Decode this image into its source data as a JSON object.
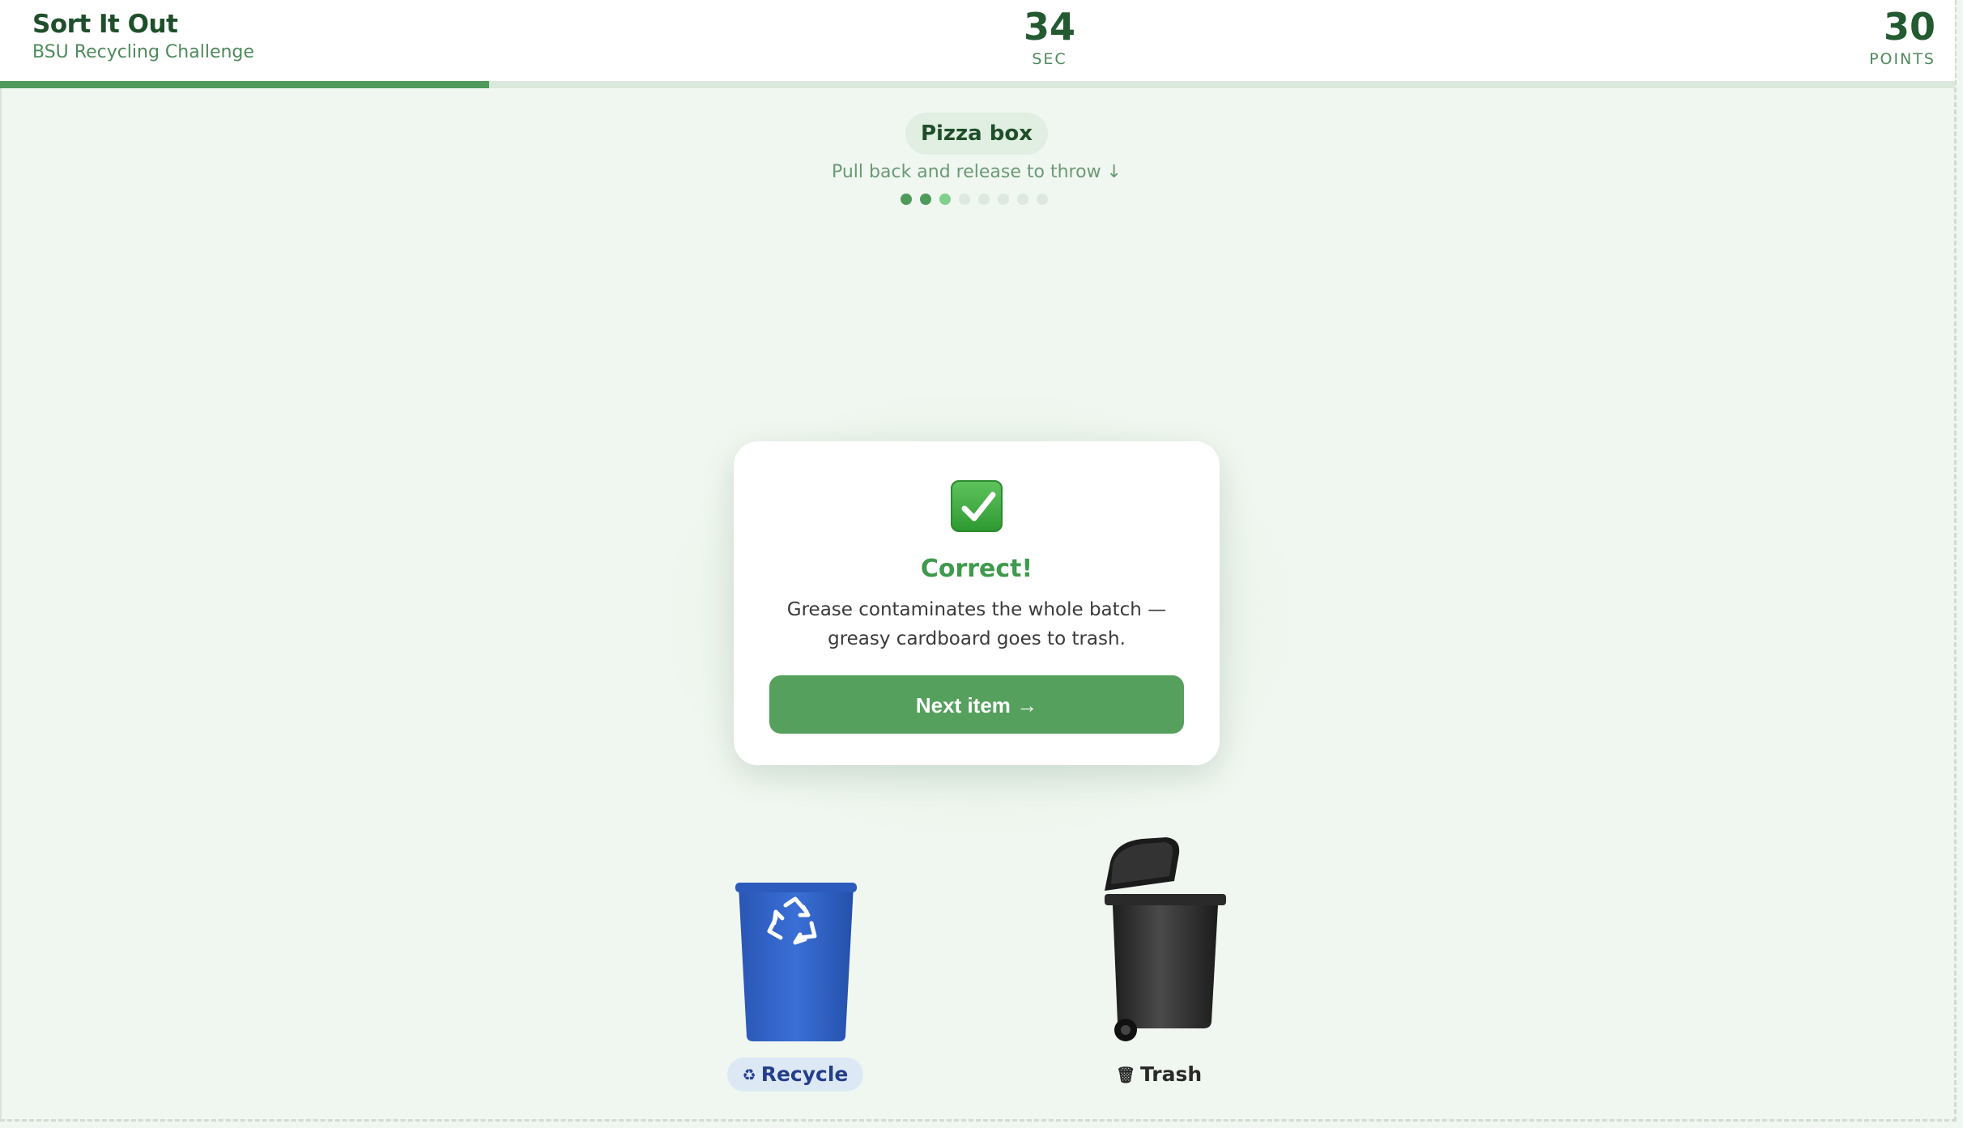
{
  "header": {
    "title": "Sort It Out",
    "subtitle": "BSU Recycling Challenge",
    "timer_value": "34",
    "timer_label": "SEC",
    "points_value": "30",
    "points_label": "POINTS",
    "time_progress_fraction": 0.25
  },
  "item": {
    "name": "Pizza box",
    "hint": "Pull back and release to throw ↓",
    "progress_dots": {
      "total": 8,
      "completed": 2,
      "current": 3
    }
  },
  "feedback": {
    "icon": "checkmark-icon",
    "title": "Correct!",
    "message": "Grease contaminates the whole batch — greasy cardboard goes to trash.",
    "next_button_label": "Next item →"
  },
  "bins": {
    "recycle": {
      "label": "Recycle",
      "icon": "recycle-symbol-icon",
      "color": "#2f5fc4"
    },
    "trash": {
      "label": "Trash",
      "icon": "wastebasket-icon",
      "color": "#2b2b2b"
    }
  },
  "colors": {
    "accent": "#4e9a5b",
    "background": "#f0f7f0",
    "title_green": "#1f4f2a"
  }
}
